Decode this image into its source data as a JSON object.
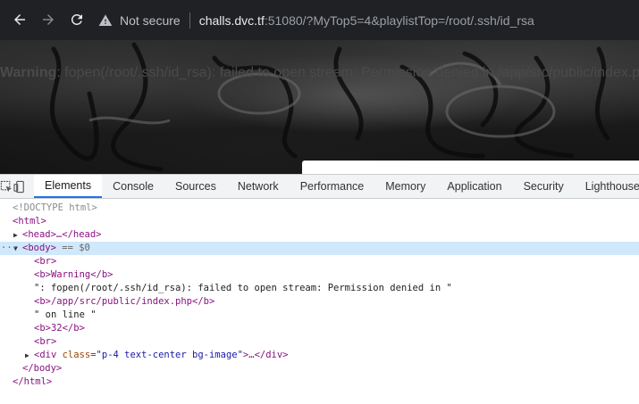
{
  "browser": {
    "security_label": "Not secure",
    "url_host": "challs.dvc.tf",
    "url_rest": ":51080/?MyTop5=4&playlistTop=/root/.ssh/id_rsa"
  },
  "page": {
    "warning_bold": "Warning",
    "warning_text": ": fopen(/root/.ssh/id_rsa): failed to open stream: Permission denied in /app/src/public/index.p"
  },
  "devtools": {
    "tabs": [
      "Elements",
      "Console",
      "Sources",
      "Network",
      "Performance",
      "Memory",
      "Application",
      "Security",
      "Lighthouse"
    ],
    "active_tab": "Elements",
    "dom": {
      "doctype": "<!DOCTYPE html>",
      "html_open": "<html>",
      "head": "<head>…</head>",
      "body_open": "<body>",
      "body_eq": " == $0",
      "br1": "<br>",
      "b_warning": "<b>Warning</b>",
      "text1": "\": fopen(/root/.ssh/id_rsa): failed to open stream: Permission denied in \"",
      "b_path": "<b>/app/src/public/index.php</b>",
      "text2": "\" on line \"",
      "b_line": "<b>32</b>",
      "br2": "<br>",
      "div_open": "<div ",
      "div_attr_name": "class",
      "div_attr_value": "\"p-4 text-center bg-image\"",
      "div_close": ">…</div>",
      "body_close": "</body>",
      "html_close": "</html>"
    }
  }
}
